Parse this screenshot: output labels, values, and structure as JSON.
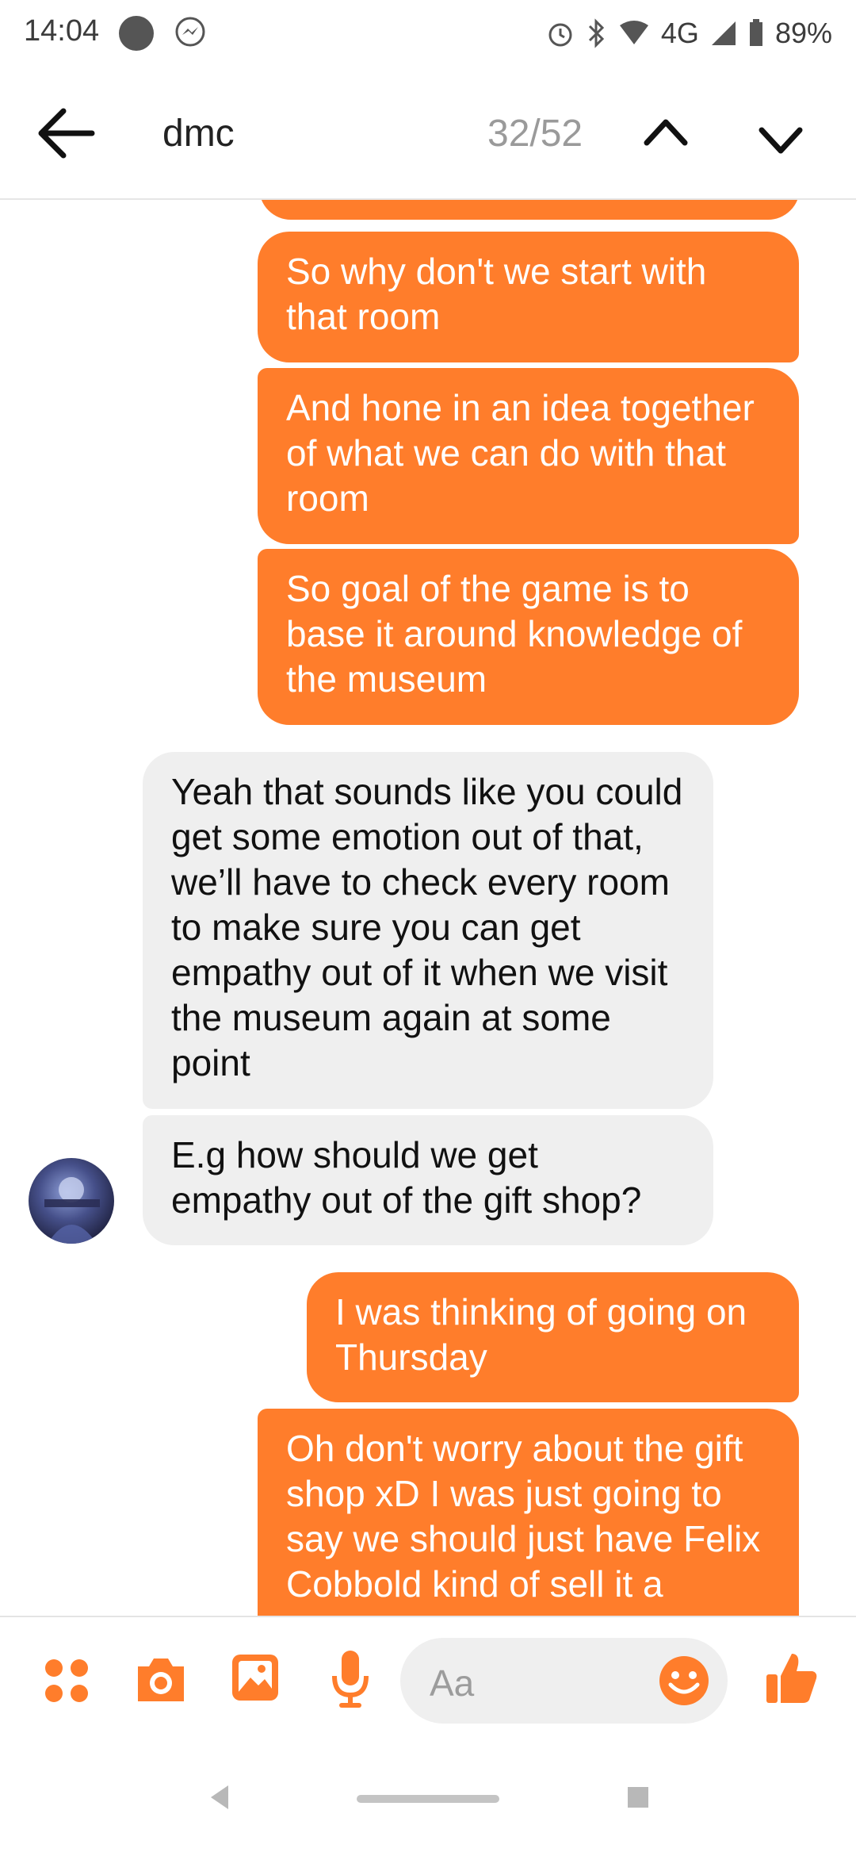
{
  "status_bar": {
    "time": "14:04",
    "network": "4G",
    "battery": "89%"
  },
  "header": {
    "search_query": "dmc",
    "result_counter": "32/52"
  },
  "messages": [
    {
      "from": "me",
      "text": "So why don't we start with that room"
    },
    {
      "from": "me",
      "text": "And hone in an idea together of what we can do with that room"
    },
    {
      "from": "me",
      "text": "So goal of the game is to base it around knowledge of the museum"
    },
    {
      "from": "them",
      "text": "Yeah that sounds like you could get some emotion out of that, we’ll have to check every room to make sure you can get empathy out of it when we visit the museum again at some point"
    },
    {
      "from": "them",
      "text": "E.g how should we get empathy out of the gift shop?"
    },
    {
      "from": "me",
      "text": "I was thinking of going on Thursday"
    },
    {
      "from": "me",
      "text": "Oh don't worry about the gift shop xD I was just going to say we should just have Felix Cobbold kind of sell it a"
    }
  ],
  "composer": {
    "placeholder": "Aa",
    "icons": [
      "apps-icon",
      "camera-icon",
      "gallery-icon",
      "microphone-icon",
      "emoji-icon",
      "thumbs-up-icon"
    ]
  },
  "colors": {
    "accent": "#ff7d2b",
    "incoming_bubble": "#efefef",
    "outgoing_text": "#ffffff"
  }
}
